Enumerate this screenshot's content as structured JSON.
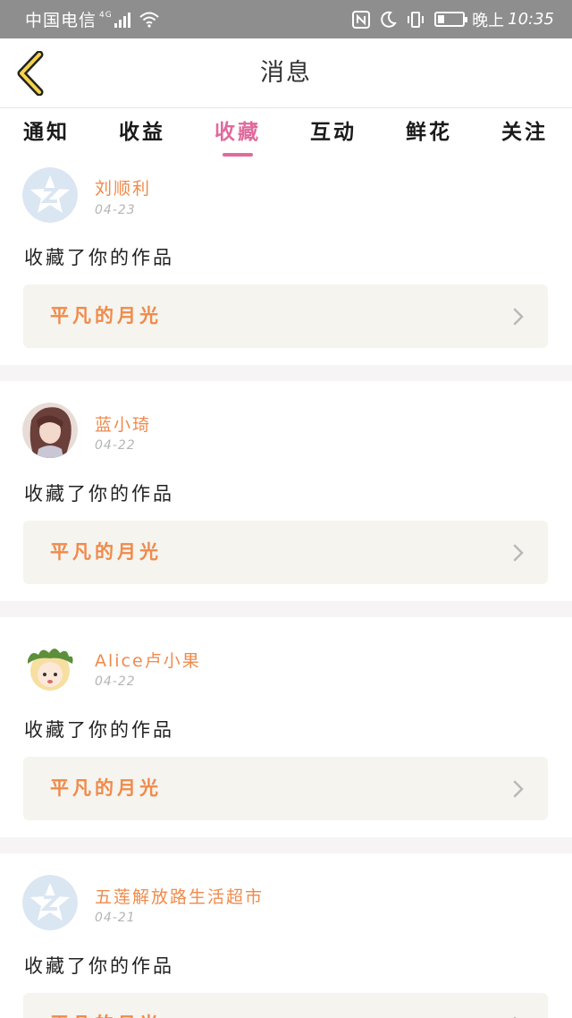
{
  "status_bar": {
    "carrier": "中国电信",
    "network": "4G",
    "time_label": "晚上",
    "time": "10:35"
  },
  "header": {
    "title": "消息",
    "back_icon": "chevron-left-icon"
  },
  "tabs": [
    {
      "label": "通知",
      "active": false
    },
    {
      "label": "收益",
      "active": false
    },
    {
      "label": "收藏",
      "active": true
    },
    {
      "label": "互动",
      "active": false
    },
    {
      "label": "鲜花",
      "active": false
    },
    {
      "label": "关注",
      "active": false
    }
  ],
  "colors": {
    "accent": "#e06a9c",
    "name": "#f08a4b",
    "work_box_bg": "#f5f4ee",
    "separator": "#f6f4f4"
  },
  "notifications": [
    {
      "user": "刘顺利",
      "date": "04-23",
      "avatar": "default-avatar-icon",
      "message": "收藏了你的作品",
      "work_title": "平凡的月光"
    },
    {
      "user": "蓝小琦",
      "date": "04-22",
      "avatar": "anime-girl-avatar",
      "message": "收藏了你的作品",
      "work_title": "平凡的月光"
    },
    {
      "user": "Alice卢小果",
      "date": "04-22",
      "avatar": "leaf-crown-avatar",
      "message": "收藏了你的作品",
      "work_title": "平凡的月光"
    },
    {
      "user": "五莲解放路生活超市",
      "date": "04-21",
      "avatar": "default-avatar-icon",
      "message": "收藏了你的作品",
      "work_title": "平凡的月光"
    }
  ]
}
